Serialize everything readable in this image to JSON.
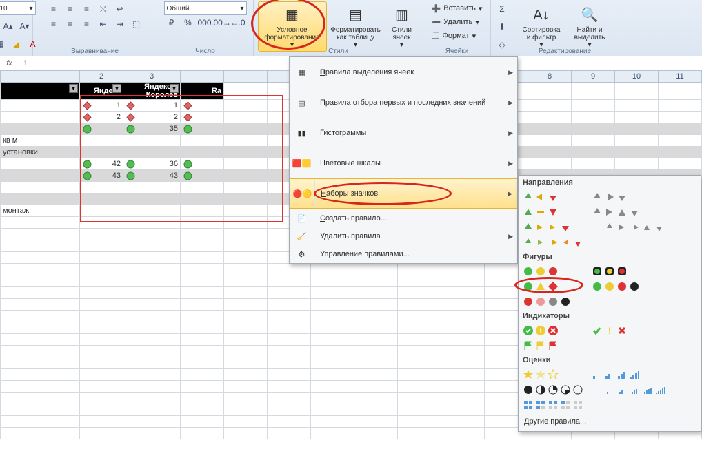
{
  "ribbon": {
    "font_size": "10",
    "num_format": "Общий",
    "groups": {
      "align": "Выравнивание",
      "number": "Число",
      "styles": "Стили",
      "cells": "Ячейки",
      "editing": "Редактирование"
    },
    "styles": {
      "cond": "Условное форматирование",
      "table": "Форматировать как таблицу",
      "cell": "Стили ячеек"
    },
    "cells": {
      "insert": "Вставить",
      "delete": "Удалить",
      "format": "Формат"
    },
    "editing": {
      "sort": "Сортировка и фильтр",
      "find": "Найти и выделить"
    }
  },
  "fx": {
    "label": "fx",
    "value": "1"
  },
  "colnums": [
    "2",
    "3",
    "8",
    "9",
    "10",
    "11"
  ],
  "headers": [
    "Яндекс",
    "Яндекс в Королев",
    "Ra"
  ],
  "rows": [
    {
      "a": "",
      "cells": [
        {
          "i": "rd",
          "v": "1"
        },
        {
          "i": "rd",
          "v": "1"
        },
        {
          "i": "rd",
          "v": ""
        }
      ],
      "grey": false
    },
    {
      "a": "",
      "cells": [
        {
          "i": "rd",
          "v": "2"
        },
        {
          "i": "rd",
          "v": "2"
        },
        {
          "i": "rd",
          "v": ""
        }
      ],
      "grey": false
    },
    {
      "a": "",
      "cells": [
        {
          "i": "gc",
          "v": ""
        },
        {
          "i": "gc",
          "v": "35"
        },
        {
          "i": "gc",
          "v": ""
        }
      ],
      "grey": true
    },
    {
      "a": "кв м",
      "cells": [
        {
          "v": ""
        },
        {
          "v": ""
        },
        {
          "v": ""
        }
      ],
      "grey": false
    },
    {
      "a": "установки",
      "cells": [
        {
          "v": ""
        },
        {
          "v": ""
        },
        {
          "v": ""
        }
      ],
      "grey": true
    },
    {
      "a": "",
      "cells": [
        {
          "i": "gc",
          "v": "42"
        },
        {
          "i": "gc",
          "v": "36"
        },
        {
          "i": "gc",
          "v": ""
        }
      ],
      "grey": false
    },
    {
      "a": "",
      "cells": [
        {
          "i": "gc",
          "v": "43"
        },
        {
          "i": "gc",
          "v": "43"
        },
        {
          "i": "gc",
          "v": ""
        }
      ],
      "grey": true
    },
    {
      "a": "",
      "cells": [
        {
          "v": ""
        },
        {
          "v": ""
        },
        {
          "v": ""
        }
      ],
      "grey": false
    },
    {
      "a": "",
      "cells": [
        {
          "v": ""
        },
        {
          "v": ""
        },
        {
          "v": ""
        }
      ],
      "grey": true
    },
    {
      "a": "монтаж",
      "cells": [
        {
          "v": ""
        },
        {
          "v": ""
        },
        {
          "v": ""
        }
      ],
      "grey": false
    }
  ],
  "menu": {
    "highlight": "Правила выделения ячеек",
    "topbottom": "Правила отбора первых и последних значений",
    "databars": "Гистограммы",
    "colorscales": "Цветовые шкалы",
    "iconsets": "Наборы значков",
    "new": "Создать правило...",
    "clear": "Удалить правила",
    "manage": "Управление правилами..."
  },
  "gallery": {
    "dir": "Направления",
    "shapes": "Фигуры",
    "ind": "Индикаторы",
    "ratings": "Оценки",
    "more": "Другие правила..."
  }
}
